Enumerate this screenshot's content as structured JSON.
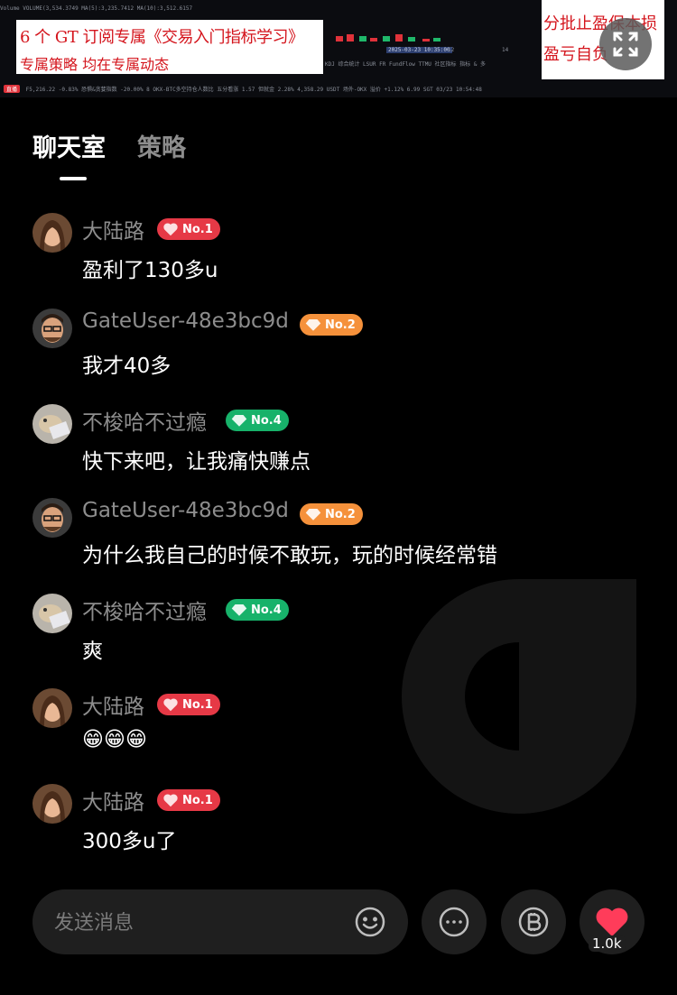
{
  "video": {
    "ticker_row": "Volume VOLUME(3,534.3749  MA(5):3,235.7412  MA(10):3,512.6157",
    "tool_row": "KDJ  综合统计  LSUR  FR  FundFlow  TTMU  社区指标  指标 & 多",
    "date_label": "2025-03-23 10:35:00",
    "tick_12": "12",
    "tick_14": "14",
    "status_row": "F5,216.22 -0.83%   恐惧&贪婪指数 -20.00% 8   OKX-BTC多空持仓人数比 五分看涨 1.57   但就金 2.28% 4,358.29   USDT 场外-OKX 溢价 +1.12% 6.99   SGT 03/23 10:54:48",
    "live_label": "直播",
    "caption_left_line1": "6 个 GT 订阅专属《交易入门指标学习》",
    "caption_left_line2": "专属策略  均在专属动态",
    "caption_right_line1": "分批止盈保本损",
    "caption_right_line2": "盈亏自负"
  },
  "tabs": [
    {
      "label": "聊天室",
      "active": true
    },
    {
      "label": "策略",
      "active": false
    }
  ],
  "messages": [
    {
      "user": "大陆路",
      "rank": "No.1",
      "text": "盈利了130多u"
    },
    {
      "user": "GateUser-48e3bc9d",
      "rank": "No.2",
      "text": "我才40多"
    },
    {
      "user": "不梭哈不过瘾",
      "rank": "No.4",
      "text": "快下来吧，让我痛快赚点"
    },
    {
      "user": "GateUser-48e3bc9d",
      "rank": "No.2",
      "text": "为什么我自己的时候不敢玩，玩的时候经常错"
    },
    {
      "user": "不梭哈不过瘾",
      "rank": "No.4",
      "text": "爽"
    },
    {
      "user": "大陆路",
      "rank": "No.1",
      "text": "😁😁😁"
    },
    {
      "user": "大陆路",
      "rank": "No.1",
      "text": "300多u了"
    }
  ],
  "rank_colors": {
    "No.1": "#e63946",
    "No.2": "#f5913b",
    "No.4": "#17b26a"
  },
  "input": {
    "placeholder": "发送消息"
  },
  "like_count": "1.0k"
}
